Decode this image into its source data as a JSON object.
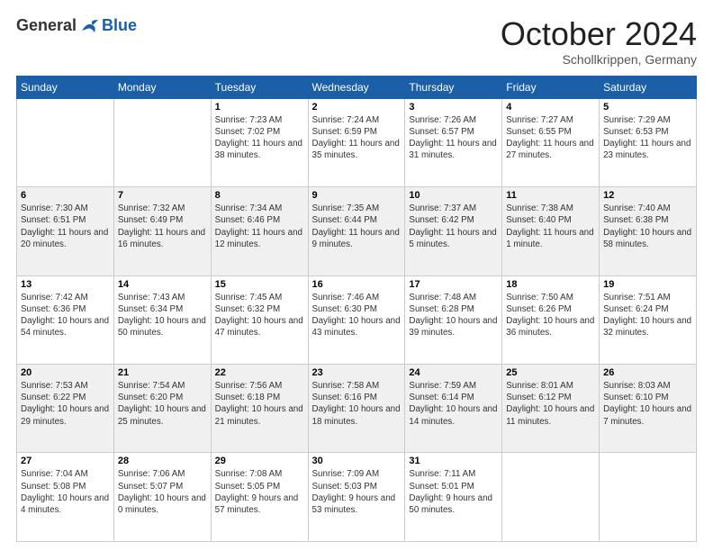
{
  "header": {
    "logo_general": "General",
    "logo_blue": "Blue",
    "month_title": "October 2024",
    "location": "Schollkrippen, Germany"
  },
  "days_of_week": [
    "Sunday",
    "Monday",
    "Tuesday",
    "Wednesday",
    "Thursday",
    "Friday",
    "Saturday"
  ],
  "weeks": [
    [
      {
        "day": "",
        "info": ""
      },
      {
        "day": "",
        "info": ""
      },
      {
        "day": "1",
        "info": "Sunrise: 7:23 AM\nSunset: 7:02 PM\nDaylight: 11 hours and 38 minutes."
      },
      {
        "day": "2",
        "info": "Sunrise: 7:24 AM\nSunset: 6:59 PM\nDaylight: 11 hours and 35 minutes."
      },
      {
        "day": "3",
        "info": "Sunrise: 7:26 AM\nSunset: 6:57 PM\nDaylight: 11 hours and 31 minutes."
      },
      {
        "day": "4",
        "info": "Sunrise: 7:27 AM\nSunset: 6:55 PM\nDaylight: 11 hours and 27 minutes."
      },
      {
        "day": "5",
        "info": "Sunrise: 7:29 AM\nSunset: 6:53 PM\nDaylight: 11 hours and 23 minutes."
      }
    ],
    [
      {
        "day": "6",
        "info": "Sunrise: 7:30 AM\nSunset: 6:51 PM\nDaylight: 11 hours and 20 minutes."
      },
      {
        "day": "7",
        "info": "Sunrise: 7:32 AM\nSunset: 6:49 PM\nDaylight: 11 hours and 16 minutes."
      },
      {
        "day": "8",
        "info": "Sunrise: 7:34 AM\nSunset: 6:46 PM\nDaylight: 11 hours and 12 minutes."
      },
      {
        "day": "9",
        "info": "Sunrise: 7:35 AM\nSunset: 6:44 PM\nDaylight: 11 hours and 9 minutes."
      },
      {
        "day": "10",
        "info": "Sunrise: 7:37 AM\nSunset: 6:42 PM\nDaylight: 11 hours and 5 minutes."
      },
      {
        "day": "11",
        "info": "Sunrise: 7:38 AM\nSunset: 6:40 PM\nDaylight: 11 hours and 1 minute."
      },
      {
        "day": "12",
        "info": "Sunrise: 7:40 AM\nSunset: 6:38 PM\nDaylight: 10 hours and 58 minutes."
      }
    ],
    [
      {
        "day": "13",
        "info": "Sunrise: 7:42 AM\nSunset: 6:36 PM\nDaylight: 10 hours and 54 minutes."
      },
      {
        "day": "14",
        "info": "Sunrise: 7:43 AM\nSunset: 6:34 PM\nDaylight: 10 hours and 50 minutes."
      },
      {
        "day": "15",
        "info": "Sunrise: 7:45 AM\nSunset: 6:32 PM\nDaylight: 10 hours and 47 minutes."
      },
      {
        "day": "16",
        "info": "Sunrise: 7:46 AM\nSunset: 6:30 PM\nDaylight: 10 hours and 43 minutes."
      },
      {
        "day": "17",
        "info": "Sunrise: 7:48 AM\nSunset: 6:28 PM\nDaylight: 10 hours and 39 minutes."
      },
      {
        "day": "18",
        "info": "Sunrise: 7:50 AM\nSunset: 6:26 PM\nDaylight: 10 hours and 36 minutes."
      },
      {
        "day": "19",
        "info": "Sunrise: 7:51 AM\nSunset: 6:24 PM\nDaylight: 10 hours and 32 minutes."
      }
    ],
    [
      {
        "day": "20",
        "info": "Sunrise: 7:53 AM\nSunset: 6:22 PM\nDaylight: 10 hours and 29 minutes."
      },
      {
        "day": "21",
        "info": "Sunrise: 7:54 AM\nSunset: 6:20 PM\nDaylight: 10 hours and 25 minutes."
      },
      {
        "day": "22",
        "info": "Sunrise: 7:56 AM\nSunset: 6:18 PM\nDaylight: 10 hours and 21 minutes."
      },
      {
        "day": "23",
        "info": "Sunrise: 7:58 AM\nSunset: 6:16 PM\nDaylight: 10 hours and 18 minutes."
      },
      {
        "day": "24",
        "info": "Sunrise: 7:59 AM\nSunset: 6:14 PM\nDaylight: 10 hours and 14 minutes."
      },
      {
        "day": "25",
        "info": "Sunrise: 8:01 AM\nSunset: 6:12 PM\nDaylight: 10 hours and 11 minutes."
      },
      {
        "day": "26",
        "info": "Sunrise: 8:03 AM\nSunset: 6:10 PM\nDaylight: 10 hours and 7 minutes."
      }
    ],
    [
      {
        "day": "27",
        "info": "Sunrise: 7:04 AM\nSunset: 5:08 PM\nDaylight: 10 hours and 4 minutes."
      },
      {
        "day": "28",
        "info": "Sunrise: 7:06 AM\nSunset: 5:07 PM\nDaylight: 10 hours and 0 minutes."
      },
      {
        "day": "29",
        "info": "Sunrise: 7:08 AM\nSunset: 5:05 PM\nDaylight: 9 hours and 57 minutes."
      },
      {
        "day": "30",
        "info": "Sunrise: 7:09 AM\nSunset: 5:03 PM\nDaylight: 9 hours and 53 minutes."
      },
      {
        "day": "31",
        "info": "Sunrise: 7:11 AM\nSunset: 5:01 PM\nDaylight: 9 hours and 50 minutes."
      },
      {
        "day": "",
        "info": ""
      },
      {
        "day": "",
        "info": ""
      }
    ]
  ]
}
